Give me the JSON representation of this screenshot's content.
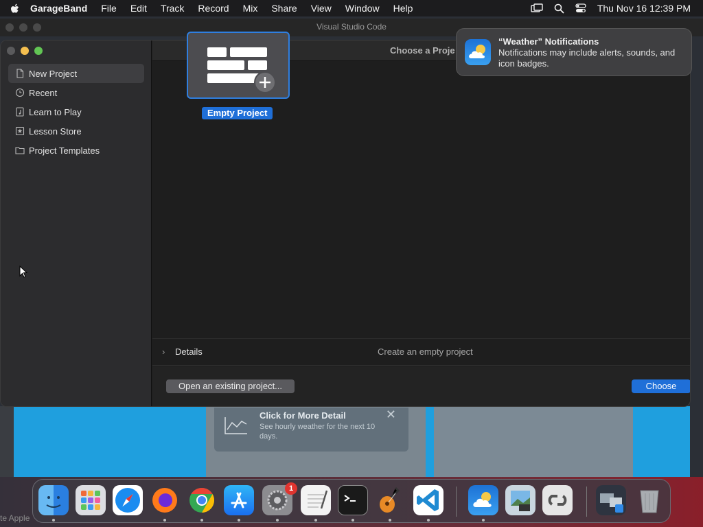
{
  "menubar": {
    "app_name": "GarageBand",
    "menus": [
      "File",
      "Edit",
      "Track",
      "Record",
      "Mix",
      "Share",
      "View",
      "Window",
      "Help"
    ],
    "clock": "Thu Nov 16  12:39 PM"
  },
  "background": {
    "vscode_title": "Visual Studio Code",
    "weather_card_title": "Click for More Detail",
    "weather_card_sub": "See hourly weather for the next 10 days.",
    "bottom_label": "te Apple"
  },
  "window": {
    "header_title": "Choose a Proje"
  },
  "sidebar": {
    "items": [
      {
        "label": "New Project",
        "icon": "document-icon"
      },
      {
        "label": "Recent",
        "icon": "clock-icon"
      },
      {
        "label": "Learn to Play",
        "icon": "music-note-icon"
      },
      {
        "label": "Lesson Store",
        "icon": "star-icon"
      },
      {
        "label": "Project Templates",
        "icon": "folder-icon"
      }
    ]
  },
  "project": {
    "label": "Empty Project"
  },
  "details": {
    "label": "Details",
    "description": "Create an empty project"
  },
  "footer": {
    "open_label": "Open an existing project...",
    "choose_label": "Choose"
  },
  "notification": {
    "title": "“Weather” Notifications",
    "body": "Notifications may include alerts, sounds, and icon badges."
  },
  "dock": {
    "badge": "1",
    "apps": [
      "Finder",
      "Launchpad",
      "Safari",
      "Firefox",
      "Chrome",
      "App Store",
      "System Settings",
      "TextEdit",
      "Terminal",
      "GarageBand",
      "Visual Studio Code",
      "Weather",
      "Preview",
      "Creative Cloud",
      "Downloads",
      "Trash"
    ]
  },
  "colors": {
    "accent": "#1f6fd8",
    "window_bg": "#1e1e1e",
    "sidebar_bg": "#2c2c2e"
  }
}
